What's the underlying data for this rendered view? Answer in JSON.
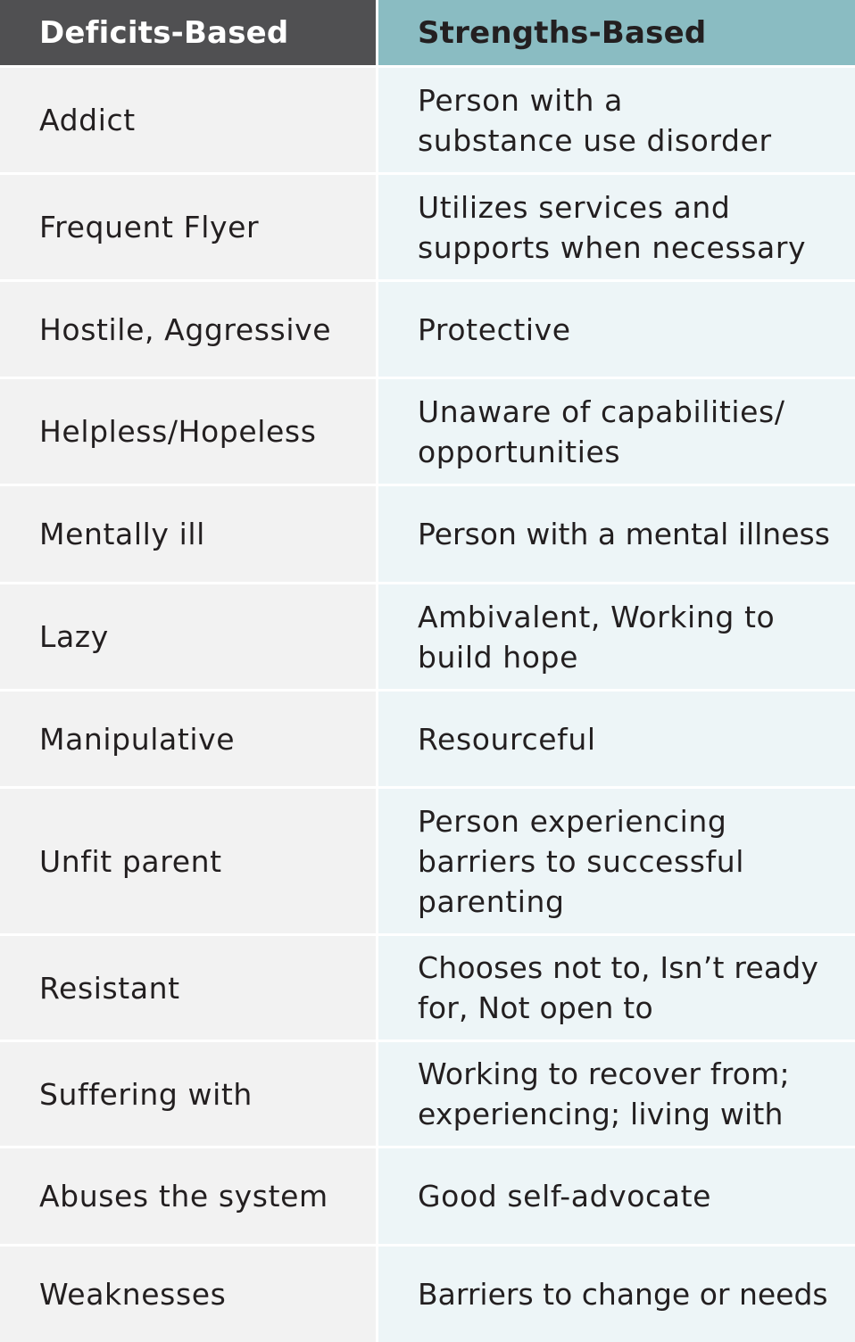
{
  "table": {
    "headers": {
      "left": "Deficits-Based",
      "right": "Strengths-Based"
    },
    "colors": {
      "header_left_bg": "#505052",
      "header_right_bg": "#8abcc2",
      "body_left_bg": "#f2f2f2",
      "body_right_bg": "#edf5f7",
      "text": "#231f20"
    },
    "rows": [
      {
        "deficit": "Addict",
        "strength": "Person with a substance use disorder"
      },
      {
        "deficit": "Frequent Flyer",
        "strength": "Utilizes services and supports when necessary"
      },
      {
        "deficit": "Hostile, Aggressive",
        "strength": "Protective"
      },
      {
        "deficit": "Helpless/Hopeless",
        "strength": "Unaware of capabilities/ opportunities"
      },
      {
        "deficit": "Mentally ill",
        "strength": "Person with a mental illness"
      },
      {
        "deficit": "Lazy",
        "strength": "Ambivalent, Working to build hope"
      },
      {
        "deficit": "Manipulative",
        "strength": "Resourceful"
      },
      {
        "deficit": "Unfit parent",
        "strength": "Person experiencing barriers to successful parenting"
      },
      {
        "deficit": "Resistant",
        "strength": "Chooses not to, Isn’t ready for, Not open to"
      },
      {
        "deficit": "Suffering with",
        "strength": "Working to recover from; experiencing; living with"
      },
      {
        "deficit": "Abuses the system",
        "strength": "Good self-advocate"
      },
      {
        "deficit": "Weaknesses",
        "strength": "Barriers to change or needs"
      }
    ]
  }
}
